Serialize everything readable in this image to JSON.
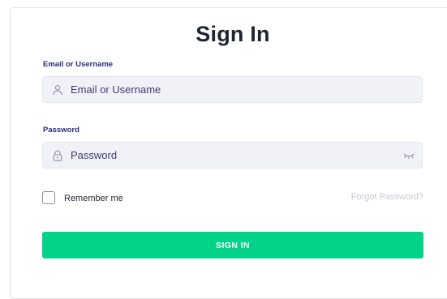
{
  "form": {
    "title": "Sign In",
    "email": {
      "label": "Email or Username",
      "placeholder": "Email or Username",
      "icon": "user-icon"
    },
    "password": {
      "label": "Password",
      "placeholder": "Password",
      "icon": "lock-icon",
      "toggle_icon": "eye-closed-icon"
    },
    "remember_label": "Remember me",
    "forgot_label": "Forgot Password?",
    "submit_label": "SIGN IN"
  },
  "colors": {
    "accent": "#03d389",
    "label": "#2a2d7c",
    "input_bg": "#f1f1f8",
    "muted_link": "#c7c8d1"
  }
}
